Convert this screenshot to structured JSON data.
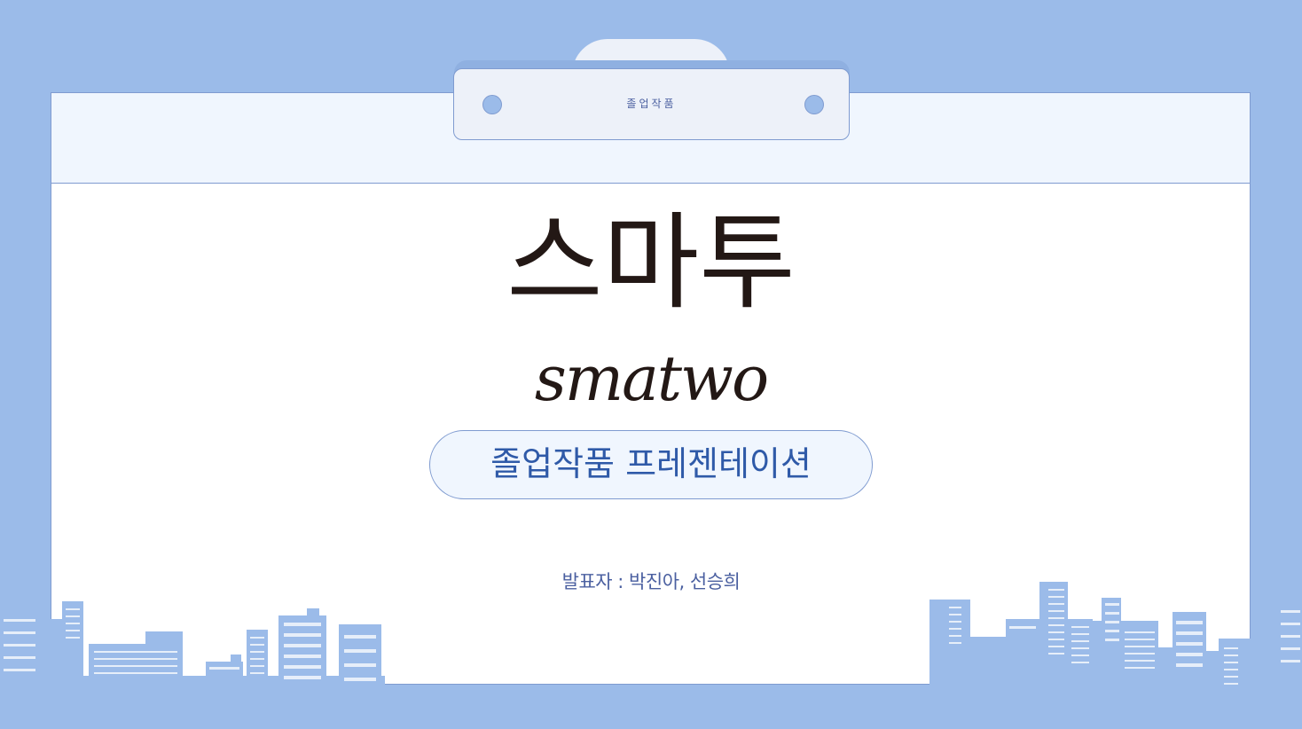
{
  "clipboard": {
    "label": "졸업작품"
  },
  "title": {
    "korean": "스마투",
    "english": "smatwo"
  },
  "subtitle": "졸업작품 프레젠테이션",
  "presenter": "발표자 : 박진아, 선승희",
  "colors": {
    "background": "#9bbbe9",
    "board": "#ffffff",
    "header": "#f0f6fe",
    "border": "#7f9bd0",
    "accent_text": "#2f5aa8",
    "title_text": "#231815",
    "building_window": "#ffffff"
  }
}
